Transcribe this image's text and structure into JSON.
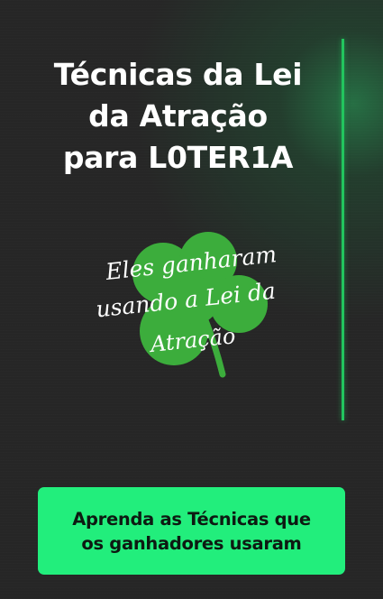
{
  "title": {
    "line1": "Técnicas da Lei",
    "line2": "da Atração",
    "line3": "para L0TER1A"
  },
  "clover": {
    "icon": "four-leaf-clover-icon",
    "caption_line1": "Eles ganharam",
    "caption_line2": "usando a Lei da",
    "caption_line3": "Atração"
  },
  "cta": {
    "line1": "Aprenda as Técnicas que",
    "line2": "os ganhadores usaram"
  },
  "colors": {
    "background": "#262626",
    "accent": "#22c55e",
    "cta_background": "#22ee7c",
    "cta_text": "#0d1a12",
    "title_text": "#ffffff"
  }
}
